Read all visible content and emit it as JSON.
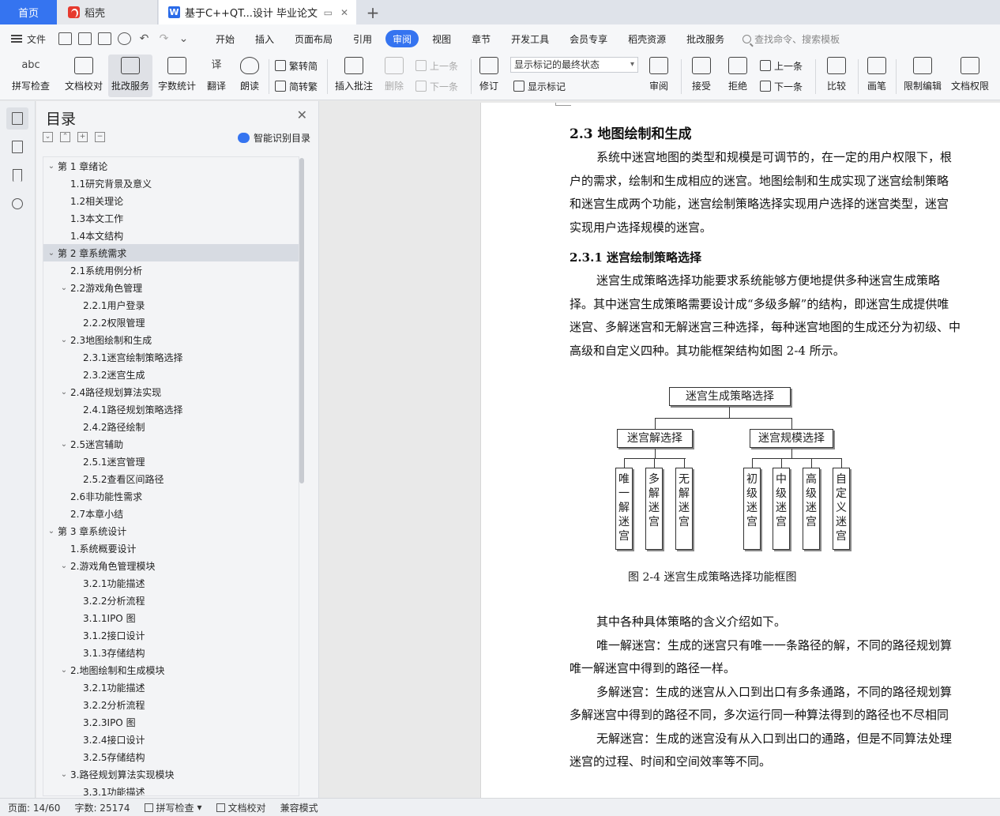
{
  "tabs": {
    "home": "首页",
    "daoke": "稻壳",
    "doc": "基于C++QT...设计 毕业论文"
  },
  "menu": {
    "file": "文件",
    "items": [
      "开始",
      "插入",
      "页面布局",
      "引用",
      "审阅",
      "视图",
      "章节",
      "开发工具",
      "会员专享",
      "稻壳资源",
      "批改服务"
    ],
    "active": "审阅",
    "search": "查找命令、搜索模板"
  },
  "ribbon": {
    "spell": "拼写检查",
    "proofread": "文档校对",
    "correct": "批改服务",
    "wordcount": "字数统计",
    "translate": "翻译",
    "read": "朗读",
    "to_trad": "繁转简",
    "to_simp": "简转繁",
    "insert_comment": "插入批注",
    "delete": "删除",
    "prev": "上一条",
    "next": "下一条",
    "revise": "修订",
    "markup_state": "显示标记的最终状态",
    "show_markup": "显示标记",
    "review": "审阅",
    "accept": "接受",
    "reject": "拒绝",
    "prev2": "上一条",
    "next2": "下一条",
    "compare": "比较",
    "pen": "画笔",
    "restrict": "限制编辑",
    "rights": "文档权限"
  },
  "toc": {
    "title": "目录",
    "smart": "智能识别目录",
    "items": [
      {
        "label": "第 1 章绪论",
        "level": 1,
        "caret": "down"
      },
      {
        "label": "1.1研究背景及意义",
        "level": 2,
        "caret": ""
      },
      {
        "label": "1.2相关理论",
        "level": 2,
        "caret": ""
      },
      {
        "label": "1.3本文工作",
        "level": 2,
        "caret": ""
      },
      {
        "label": "1.4本文结构",
        "level": 2,
        "caret": ""
      },
      {
        "label": "第 2 章系统需求",
        "level": 1,
        "caret": "down",
        "selected": true
      },
      {
        "label": "2.1系统用例分析",
        "level": 2,
        "caret": ""
      },
      {
        "label": "2.2游戏角色管理",
        "level": 2,
        "caret": "down"
      },
      {
        "label": "2.2.1用户登录",
        "level": 3,
        "caret": ""
      },
      {
        "label": "2.2.2权限管理",
        "level": 3,
        "caret": ""
      },
      {
        "label": "2.3地图绘制和生成",
        "level": 2,
        "caret": "down"
      },
      {
        "label": "2.3.1迷宫绘制策略选择",
        "level": 3,
        "caret": ""
      },
      {
        "label": "2.3.2迷宫生成",
        "level": 3,
        "caret": ""
      },
      {
        "label": "2.4路径规划算法实现",
        "level": 2,
        "caret": "down"
      },
      {
        "label": "2.4.1路径规划策略选择",
        "level": 3,
        "caret": ""
      },
      {
        "label": "2.4.2路径绘制",
        "level": 3,
        "caret": ""
      },
      {
        "label": "2.5迷宫辅助",
        "level": 2,
        "caret": "down"
      },
      {
        "label": "2.5.1迷宫管理",
        "level": 3,
        "caret": ""
      },
      {
        "label": "2.5.2查看区间路径",
        "level": 3,
        "caret": ""
      },
      {
        "label": "2.6非功能性需求",
        "level": 2,
        "caret": ""
      },
      {
        "label": "2.7本章小结",
        "level": 2,
        "caret": ""
      },
      {
        "label": "第 3 章系统设计",
        "level": 1,
        "caret": "down"
      },
      {
        "label": "1.系统概要设计",
        "level": 2,
        "caret": ""
      },
      {
        "label": "2.游戏角色管理模块",
        "level": 2,
        "caret": "down"
      },
      {
        "label": "3.2.1功能描述",
        "level": 3,
        "caret": ""
      },
      {
        "label": "3.2.2分析流程",
        "level": 3,
        "caret": ""
      },
      {
        "label": "3.1.1IPO 图",
        "level": 3,
        "caret": ""
      },
      {
        "label": "3.1.2接口设计",
        "level": 3,
        "caret": ""
      },
      {
        "label": "3.1.3存储结构",
        "level": 3,
        "caret": ""
      },
      {
        "label": "2.地图绘制和生成模块",
        "level": 2,
        "caret": "down"
      },
      {
        "label": "3.2.1功能描述",
        "level": 3,
        "caret": ""
      },
      {
        "label": "3.2.2分析流程",
        "level": 3,
        "caret": ""
      },
      {
        "label": "3.2.3IPO 图",
        "level": 3,
        "caret": ""
      },
      {
        "label": "3.2.4接口设计",
        "level": 3,
        "caret": ""
      },
      {
        "label": "3.2.5存储结构",
        "level": 3,
        "caret": ""
      },
      {
        "label": "3.路径规划算法实现模块",
        "level": 2,
        "caret": "down"
      },
      {
        "label": "3.3.1功能描述",
        "level": 3,
        "caret": ""
      }
    ]
  },
  "doc": {
    "h2": "2.3   地图绘制和生成",
    "para1": [
      "系统中迷宫地图的类型和规模是可调节的，在一定的用户权限下，根",
      "户的需求，绘制和生成相应的迷宫。地图绘制和生成实现了迷宫绘制策略",
      "和迷宫生成两个功能，迷宫绘制策略选择实现用户选择的迷宫类型，迷宫",
      "实现用户选择规模的迷宫。"
    ],
    "h3": "2.3.1   迷宫绘制策略选择",
    "para2": [
      "迷宫生成策略选择功能要求系统能够方便地提供多种迷宫生成策略",
      "择。其中迷宫生成策略需要设计成“多级多解”的结构，即迷宫生成提供唯",
      "迷宫、多解迷宫和无解迷宫三种选择，每种迷宫地图的生成还分为初级、中",
      "高级和自定义四种。其功能框架结构如图 2-4 所示。"
    ],
    "diagram": {
      "root": "迷宫生成策略选择",
      "left": "迷宫解选择",
      "right": "迷宫规模选择",
      "left_children": [
        "唯一解迷宫",
        "多解迷宫",
        "无解迷宫"
      ],
      "right_children": [
        "初级迷宫",
        "中级迷宫",
        "高级迷宫",
        "自定义迷宫"
      ]
    },
    "caption": "图 2-4    迷宫生成策略选择功能框图",
    "para3": [
      {
        "text": "其中各种具体策略的含义介绍如下。",
        "indent": true
      },
      {
        "text": "唯一解迷宫：生成的迷宫只有唯一一条路径的解，不同的路径规划算",
        "indent": true
      },
      {
        "text": "唯一解迷宫中得到的路径一样。",
        "indent": false
      },
      {
        "text": "多解迷宫：生成的迷宫从入口到出口有多条通路，不同的路径规划算",
        "indent": true
      },
      {
        "text": "多解迷宫中得到的路径不同，多次运行同一种算法得到的路径也不尽相同",
        "indent": false
      },
      {
        "text": "无解迷宫：生成的迷宫没有从入口到出口的通路，但是不同算法处理",
        "indent": true
      },
      {
        "text": "迷宫的过程、时间和空间效率等不同。",
        "indent": false
      }
    ]
  },
  "status": {
    "page": "页面: 14/60",
    "words": "字数: 25174",
    "spell": "拼写检查",
    "proof": "文档校对",
    "compat": "兼容模式"
  }
}
